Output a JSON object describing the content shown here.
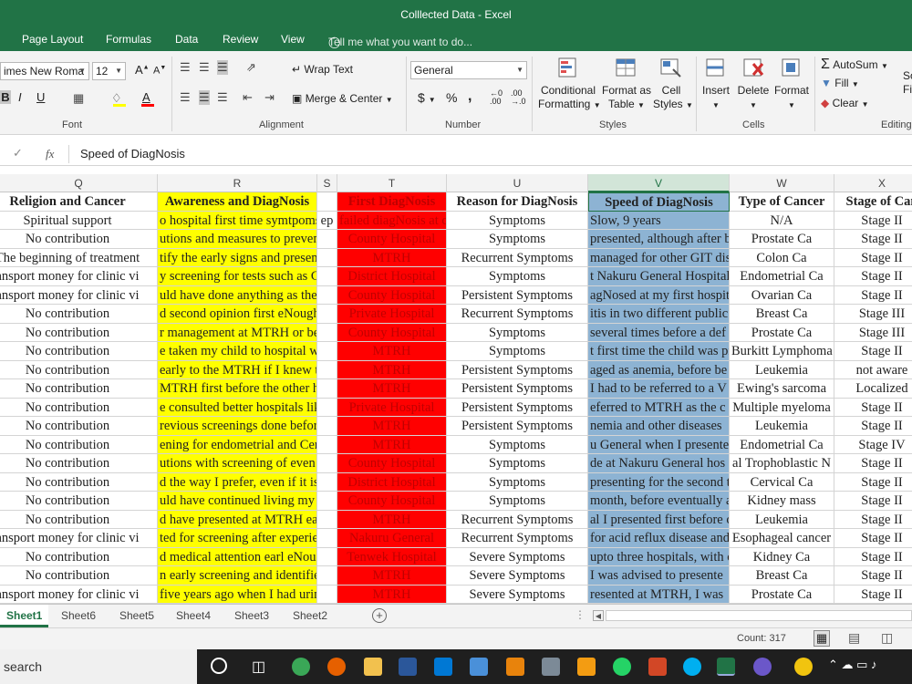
{
  "window": {
    "title": "Colllected Data  -  Excel"
  },
  "tabs": [
    "Page Layout",
    "Formulas",
    "Data",
    "Review",
    "View"
  ],
  "tell_me": "Tell me what you want to do...",
  "ribbon": {
    "font_name": "imes New Roma",
    "font_size": "12",
    "number_format": "General",
    "wrap_text": "Wrap Text",
    "merge_center": "Merge & Center",
    "conditional_formatting": [
      "Conditional",
      "Formatting"
    ],
    "format_as_table": [
      "Format as",
      "Table"
    ],
    "cell_styles": [
      "Cell",
      "Styles"
    ],
    "insert": "Insert",
    "delete": "Delete",
    "format": "Format",
    "autosum": "AutoSum",
    "fill": "Fill",
    "clear": "Clear",
    "sort_frag": [
      "So",
      "Fi"
    ],
    "groups": {
      "font": "Font",
      "alignment": "Alignment",
      "number": "Number",
      "styles": "Styles",
      "cells": "Cells",
      "editing": "Editing"
    },
    "bold": "B",
    "italic": "I",
    "underline": "U",
    "grow_font": "A",
    "shrink_font": "A",
    "currency": "$",
    "percent": "%",
    "comma": ","
  },
  "formula_bar": {
    "fx": "fx",
    "value": "Speed of DiagNosis"
  },
  "columns": [
    "Q",
    "R",
    "S",
    "T",
    "U",
    "V",
    "W",
    "X"
  ],
  "headers": {
    "Q": "Religion and Cancer",
    "R": "Awareness and DiagNosis",
    "S": "",
    "T": "First DiagNosis",
    "U": "Reason for DiagNosis",
    "V": "Speed of DiagNosis",
    "W": "Type of Cancer",
    "X": "Stage of Can"
  },
  "rows": [
    [
      "Spiritual support",
      "o hospital first time symtpoms se",
      "ep",
      "failed diagNosis at c",
      "Symptoms",
      "Slow, 9 years",
      "N/A",
      "Stage II"
    ],
    [
      "No contribution",
      "utions and measures to prevent ar",
      "",
      "County Hospital",
      "Symptoms",
      "presented, although after b",
      "Prostate Ca",
      "Stage II"
    ],
    [
      "The beginning of treatment",
      "tify the early signs and present for",
      "",
      "MTRH",
      "Recurrent Symptoms",
      "managed for other GIT dise",
      "Colon Ca",
      "Stage II"
    ],
    [
      "ansport money for clinic vi",
      "y screening for tests such as Cerv",
      "",
      "District Hospital",
      "Symptoms",
      "t Nakuru General Hospital",
      "Endometrial Ca",
      "Stage II"
    ],
    [
      "ansport money for clinic vi",
      "uld have done anything as the Sym",
      "",
      "County Hospital",
      "Persistent Symptoms",
      "agNosed at my first hospit",
      "Ovarian Ca",
      "Stage II"
    ],
    [
      "No contribution",
      "d second opinion first eNough fro",
      "",
      "Private Hospital",
      "Recurrent Symptoms",
      "itis in two different public",
      "Breast Ca",
      "Stage III"
    ],
    [
      "No contribution",
      "r management at MTRH or better",
      "",
      "County Hospital",
      "Symptoms",
      "several times before a def",
      "Prostate Ca",
      "Stage III"
    ],
    [
      "No contribution",
      "e taken my child to hospital when",
      "",
      "MTRH",
      "Symptoms",
      "t first time the child was pr",
      "Burkitt Lymphoma",
      "Stage II"
    ],
    [
      "No contribution",
      "early to the MTRH if I knew the d",
      "",
      "MTRH",
      "Persistent Symptoms",
      "aged as anemia, before be",
      "Leukemia",
      "not aware"
    ],
    [
      "No contribution",
      "MTRH first before the other hospi",
      "",
      "MTRH",
      "Persistent Symptoms",
      "I had to be referred to a V",
      "Ewing's sarcoma",
      "Localized"
    ],
    [
      "No contribution",
      "e consulted better hospitals like M",
      "",
      "Private Hospital",
      "Persistent Symptoms",
      "eferred to MTRH as the c",
      "Multiple myeloma",
      "Stage II"
    ],
    [
      "No contribution",
      "revious screenings done before co",
      "",
      "MTRH",
      "Persistent Symptoms",
      "nemia and other diseases",
      "Leukemia",
      "Stage II"
    ],
    [
      "No contribution",
      "ening for endometrial and Cervical",
      "",
      "MTRH",
      "Symptoms",
      "u General when I presente",
      "Endometrial Ca",
      "Stage IV"
    ],
    [
      "No contribution",
      "utions with screening of even othe",
      "",
      "County Hospital",
      "Symptoms",
      "de at Nakuru General hos",
      "al Trophoblastic N",
      "Stage II"
    ],
    [
      "No contribution",
      "d the way I prefer, even if it is part",
      "",
      "District Hospital",
      "Symptoms",
      "presenting for the second ti",
      "Cervical Ca",
      "Stage II"
    ],
    [
      "No contribution",
      "uld have continued living my life as",
      "",
      "County Hospital",
      "Symptoms",
      "month, before eventually a",
      "Kidney mass",
      "Stage II"
    ],
    [
      "No contribution",
      "d have presented at MTRH early",
      "",
      "MTRH",
      "Recurrent Symptoms",
      "al I presented first before c",
      "Leukemia",
      "Stage II"
    ],
    [
      "ansport money for clinic vi",
      "ted for screening after experiencin",
      "",
      "Nakuru General",
      "Recurrent Symptoms",
      "for acid reflux disease and",
      "Esophageal cancer",
      "Stage II"
    ],
    [
      "No contribution",
      "d medical attention earl eNough ins",
      "",
      "Tenwek Hospital",
      "Severe Symptoms",
      "upto three hospitals, with o",
      "Kidney Ca",
      "Stage II"
    ],
    [
      "No contribution",
      "n early screening and identified the",
      "",
      "MTRH",
      "Severe Symptoms",
      "I was advised to presente",
      "Breast Ca",
      "Stage II"
    ],
    [
      "ansport money for clinic vi",
      "five years ago when  I had urinar",
      "",
      "MTRH",
      "Severe Symptoms",
      "resented at MTRH, I was",
      "Prostate Ca",
      "Stage II"
    ]
  ],
  "sheets": [
    "Sheet1",
    "Sheet6",
    "Sheet5",
    "Sheet4",
    "Sheet3",
    "Sheet2"
  ],
  "active_sheet": "Sheet1",
  "status": {
    "count": "Count: 317"
  },
  "taskbar": {
    "search": "search"
  },
  "colors": {
    "excel_green": "#217346",
    "yellow": "#ffff00",
    "red": "#ff0000",
    "blue": "#8db3d3"
  }
}
